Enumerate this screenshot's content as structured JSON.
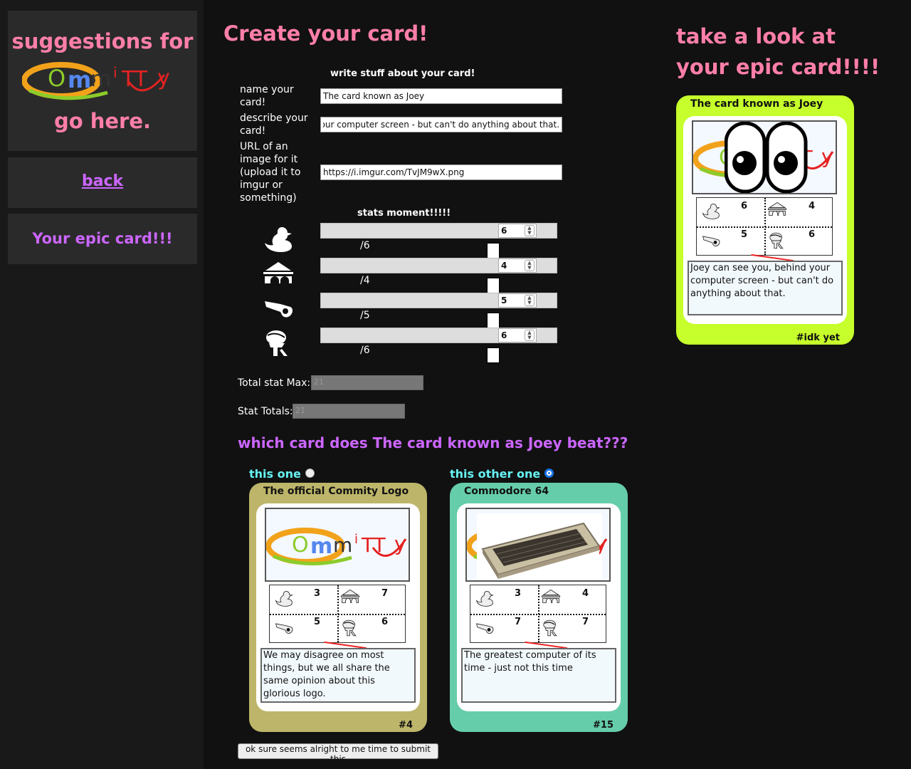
{
  "sidebar": {
    "suggestions_line1": "suggestions for",
    "logo_text": "OmmiTTy",
    "suggestions_line2": "go here.",
    "back_label": "back",
    "your_card_label": "Your epic card!!!"
  },
  "main": {
    "title": "Create your card!",
    "write_header": "write stuff about your card!",
    "name_label": "name your card!",
    "name_value": "The card known as Joey",
    "describe_label": "describe your card!",
    "describe_value": "d your computer screen - but can't do anything about that.",
    "url_label": "URL of an image for it (upload it to imgur or something)",
    "url_value": "https://i.imgur.com/TvJM9wX.png",
    "stats_header": "stats moment!!!!!",
    "stats": [
      {
        "icon": "duck-icon",
        "value": "6",
        "label": "/6"
      },
      {
        "icon": "bridge-icon",
        "value": "4",
        "label": "/4"
      },
      {
        "icon": "whistle-icon",
        "value": "5",
        "label": "/5"
      },
      {
        "icon": "robot-icon",
        "value": "6",
        "label": "/6"
      }
    ],
    "total_max_label": "Total stat Max:",
    "total_max_value": "21",
    "stat_totals_label": "Stat Totals:",
    "stat_totals_value": "21",
    "beat_question": "which card does The card known as Joey beat???",
    "option1_label": "this one",
    "option2_label": "this other one",
    "submit_label": "ok sure seems alright to me time to submit this"
  },
  "preview": {
    "title": "take a look at your epic card!!!!",
    "card": {
      "name": "The card known as Joey",
      "stats": [
        "6",
        "4",
        "5",
        "6"
      ],
      "desc": "Joey can see you, behind your computer screen - but can't do anything about that.",
      "number": "#idk yet",
      "color": "#c6ff2b"
    }
  },
  "options": [
    {
      "name": "The official Commity Logo",
      "stats": [
        "3",
        "7",
        "5",
        "6"
      ],
      "desc": "We may disagree on most things, but we all share the same opinion about this glorious logo.",
      "number": "#4",
      "color": "#bdb66a"
    },
    {
      "name": "Commodore 64",
      "stats": [
        "3",
        "4",
        "7",
        "7"
      ],
      "desc": "The greatest computer of its time - just not this time",
      "number": "#15",
      "color": "#66cdab"
    }
  ]
}
